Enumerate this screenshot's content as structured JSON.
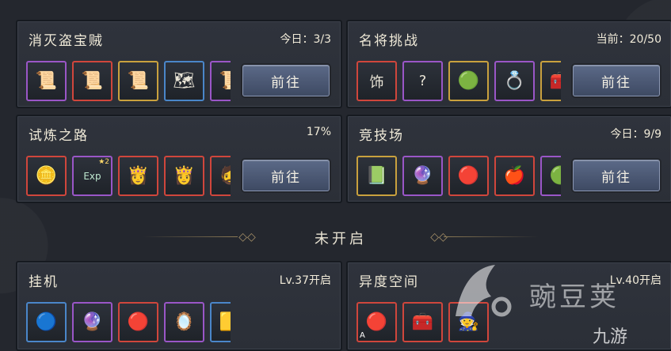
{
  "panels": {
    "thieves": {
      "title": "消灭盗宝贼",
      "status": "今日：3/3",
      "button": "前往",
      "items": [
        {
          "icon": "scroll-icon",
          "glyph": "📜",
          "rarity": "purple"
        },
        {
          "icon": "red-scroll-icon",
          "glyph": "📜",
          "rarity": "red"
        },
        {
          "icon": "gold-scroll-icon",
          "glyph": "📜",
          "rarity": "gold"
        },
        {
          "icon": "map-scroll-icon",
          "glyph": "🗺",
          "rarity": "blue"
        },
        {
          "icon": "scroll-icon",
          "glyph": "📜",
          "rarity": "purple"
        }
      ]
    },
    "generals": {
      "title": "名将挑战",
      "status": "当前：20/50",
      "button": "前往",
      "items": [
        {
          "icon": "ornament-shield-icon",
          "glyph": "饰",
          "rarity": "red"
        },
        {
          "icon": "unknown-item-icon",
          "glyph": "?",
          "rarity": "purple"
        },
        {
          "icon": "jade-pendant-icon",
          "glyph": "🟢",
          "rarity": "gold"
        },
        {
          "icon": "ring-icon",
          "glyph": "💍",
          "rarity": "purple"
        },
        {
          "icon": "chest-icon",
          "glyph": "🧰",
          "rarity": "gold"
        }
      ]
    },
    "trial": {
      "title": "试炼之路",
      "status": "17%",
      "button": "前往",
      "items": [
        {
          "icon": "gold-coin-icon",
          "glyph": "🪙",
          "rarity": "red"
        },
        {
          "icon": "exp-book-icon",
          "glyph": "Exp",
          "rarity": "purple",
          "badge": "★2"
        },
        {
          "icon": "hero-portrait-icon",
          "glyph": "👸",
          "rarity": "red"
        },
        {
          "icon": "hero-portrait-icon",
          "glyph": "👸",
          "rarity": "red"
        },
        {
          "icon": "hero-portrait-icon",
          "glyph": "🧔",
          "rarity": "red"
        }
      ]
    },
    "arena": {
      "title": "竞技场",
      "status": "今日：9/9",
      "button": "前往",
      "items": [
        {
          "icon": "jade-token-icon",
          "glyph": "📗",
          "rarity": "gold"
        },
        {
          "icon": "purple-orb-icon",
          "glyph": "🔮",
          "rarity": "purple"
        },
        {
          "icon": "red-orb-chest-icon",
          "glyph": "🔴",
          "rarity": "red"
        },
        {
          "icon": "red-fruit-icon",
          "glyph": "🍎",
          "rarity": "red"
        },
        {
          "icon": "green-orb-icon",
          "glyph": "🟢",
          "rarity": "purple"
        }
      ]
    },
    "idle": {
      "title": "挂机",
      "status": "Lv.37开启",
      "items": [
        {
          "icon": "blue-orb-icon",
          "glyph": "🔵",
          "rarity": "blue"
        },
        {
          "icon": "purple-orb-icon",
          "glyph": "🔮",
          "rarity": "purple"
        },
        {
          "icon": "red-orb-icon",
          "glyph": "🔴",
          "rarity": "red"
        },
        {
          "icon": "mystery-frame-icon",
          "glyph": "🪞",
          "rarity": "purple"
        },
        {
          "icon": "gold-bar-icon",
          "glyph": "🟨",
          "rarity": "blue"
        }
      ]
    },
    "dimension": {
      "title": "异度空间",
      "status": "Lv.40开启",
      "items": [
        {
          "icon": "red-chest-icon",
          "glyph": "🔴",
          "rarity": "red",
          "corner": "A"
        },
        {
          "icon": "treasure-chest-icon",
          "glyph": "🧰",
          "rarity": "red"
        },
        {
          "icon": "hero-portrait-icon",
          "glyph": "🧙",
          "rarity": "red"
        }
      ]
    }
  },
  "divider": {
    "label": "未开启"
  },
  "watermark": {
    "text1": "豌豆荚",
    "text2": "九游"
  }
}
